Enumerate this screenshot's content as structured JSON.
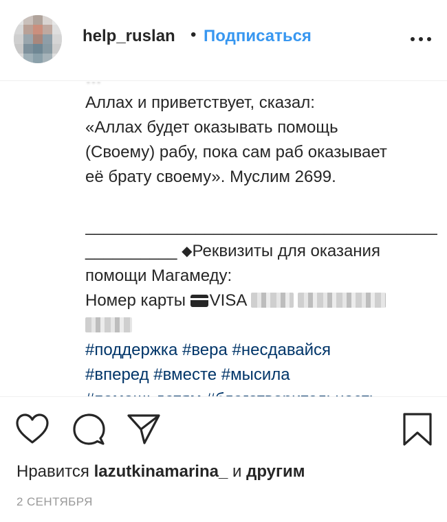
{
  "header": {
    "username": "help_ruslan",
    "separator": "•",
    "follow_label": "Подписаться"
  },
  "caption": {
    "lines": [
      "Аллах и приветствует, сказал:",
      "«Аллах будет оказывать помощь",
      "(Своему) рабу, пока сам раб оказывает",
      "её брату своему». Муслим 2699."
    ],
    "separator_line": "__________________________________________",
    "separator_tail": "__________",
    "requisites_icon": "◆",
    "requisites_text": "Реквизиты для оказания",
    "requisites_text_2": "помощи Магамеду:",
    "card_label": "Номер карты ",
    "card_brand": "VISA",
    "hashtags_line1": [
      "#поддержка",
      "#вера",
      "#несдавайся"
    ],
    "hashtags_line2": [
      "#вперед",
      "#вместе",
      "#мысила"
    ],
    "hashtags_line3": [
      "#помощьдетям",
      "#благотворительность"
    ]
  },
  "actions": {
    "like_icon": "heart-icon",
    "comment_icon": "comment-icon",
    "share_icon": "paper-plane-icon",
    "save_icon": "bookmark-icon"
  },
  "likes": {
    "prefix": "Нравится ",
    "user": "lazutkinamarina_",
    "middle": " и ",
    "others": "другим"
  },
  "date": "2 СЕНТЯБРЯ",
  "colors": {
    "link": "#3897f0",
    "hashtag": "#003569",
    "text": "#262626",
    "muted": "#999999"
  }
}
